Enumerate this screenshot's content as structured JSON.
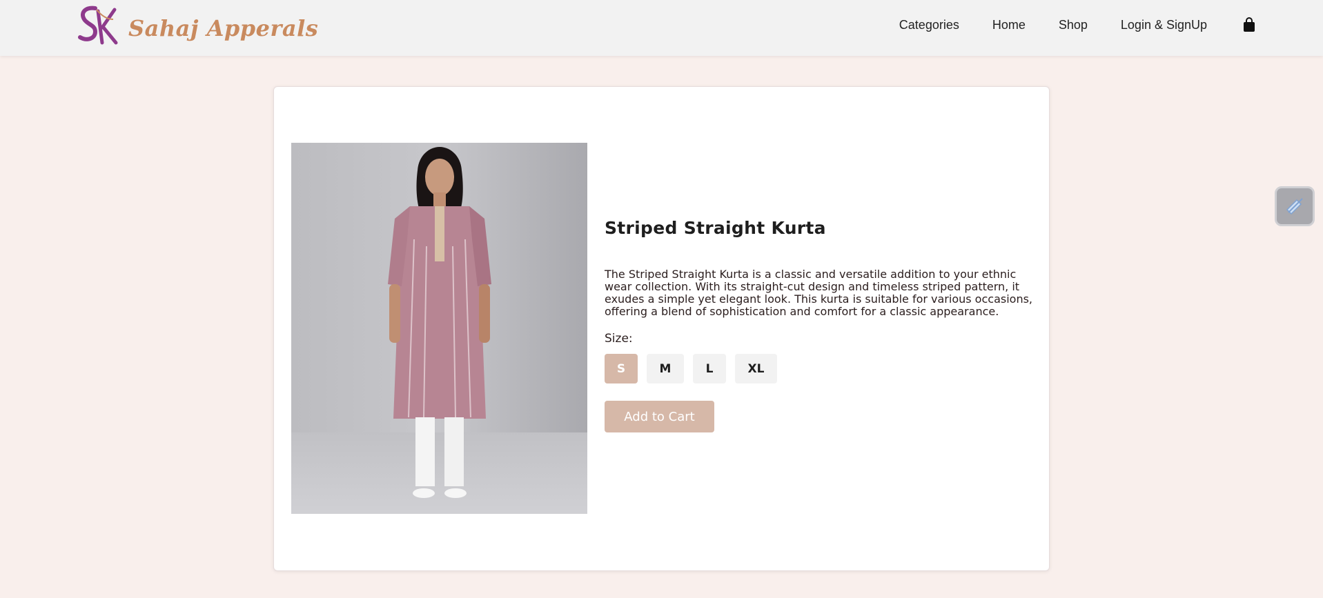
{
  "brand": {
    "name": "Sahaj Apperals",
    "logo_letters": "SK"
  },
  "nav": {
    "items": [
      {
        "label": "Categories"
      },
      {
        "label": "Home"
      },
      {
        "label": "Shop"
      },
      {
        "label": "Login & SignUp"
      }
    ],
    "cart_icon": "shopping-bag-icon"
  },
  "product": {
    "title": "Striped Straight Kurta",
    "description": "The Striped Straight Kurta is a classic and versatile addition to your ethnic wear collection. With its straight-cut design and timeless striped pattern, it exudes a simple yet elegant look. This kurta is suitable for various occasions, offering a blend of sophistication and comfort for a classic appearance.",
    "size_label": "Size:",
    "sizes": [
      "S",
      "M",
      "L",
      "XL"
    ],
    "selected_size": "S",
    "add_to_cart_label": "Add to Cart"
  },
  "colors": {
    "page_bg": "#f9efec",
    "accent": "#d6b8a8",
    "brand_text": "#c98a5e",
    "brand_mark": "#8e3a8c"
  },
  "widget": {
    "icon": "edit-pen-icon"
  }
}
